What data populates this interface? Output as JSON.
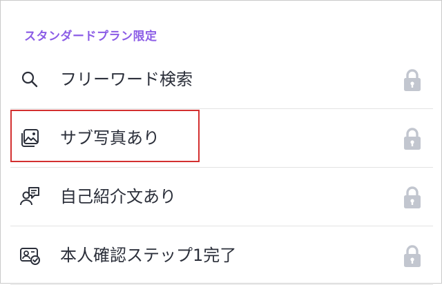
{
  "section": {
    "title": "スタンダードプラン限定"
  },
  "items": [
    {
      "label": "フリーワード検索",
      "icon": "search-icon",
      "locked": true
    },
    {
      "label": "サブ写真あり",
      "icon": "photo-stack-icon",
      "locked": true
    },
    {
      "label": "自己紹介文あり",
      "icon": "profile-message-icon",
      "locked": true
    },
    {
      "label": "本人確認ステップ1完了",
      "icon": "id-card-check-icon",
      "locked": true
    }
  ],
  "colors": {
    "section_title": "#8b5ce6",
    "text": "#2b2f3a",
    "lock": "#c2c6cf",
    "highlight": "#d32f2f"
  }
}
